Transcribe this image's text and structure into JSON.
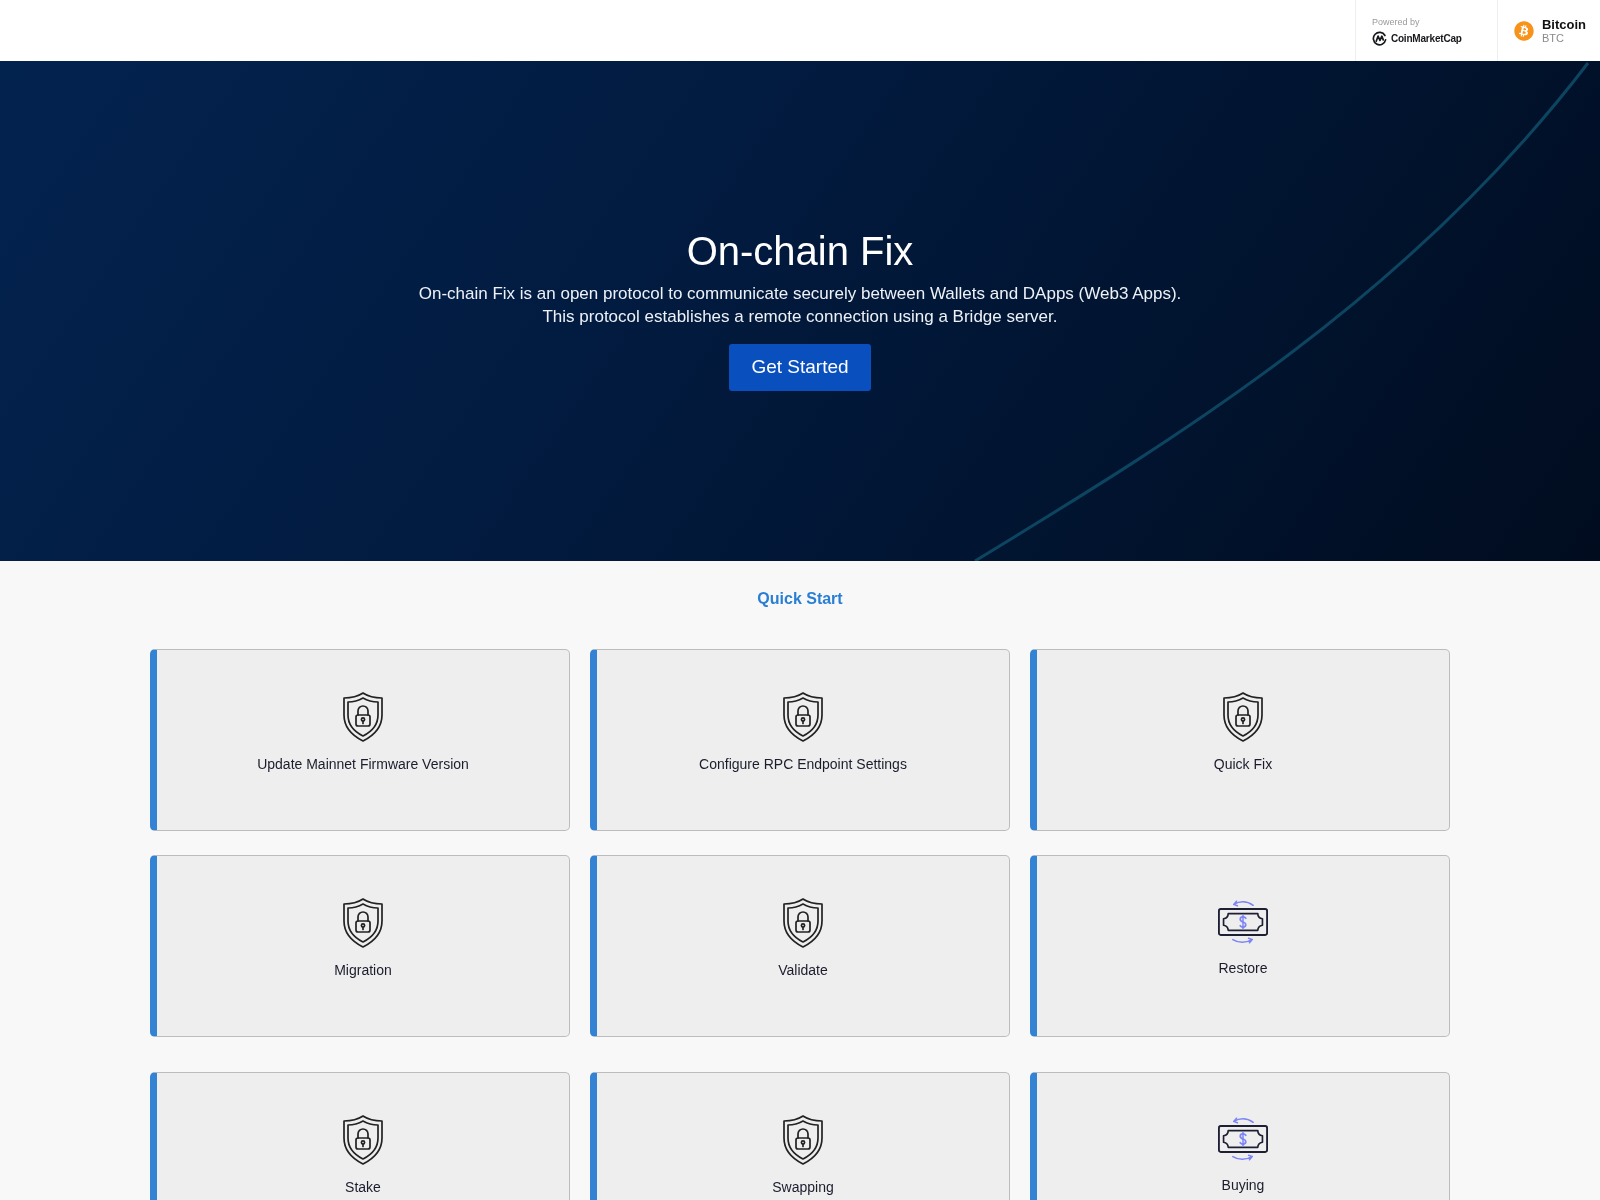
{
  "header": {
    "powered_by": "Powered by",
    "brand": "CoinMarketCap",
    "coin": {
      "name": "Bitcoin",
      "symbol": "BTC"
    }
  },
  "hero": {
    "title": "On-chain Fix",
    "description": [
      "On-chain Fix is an open protocol to communicate securely between Wallets and DApps (Web3 Apps).",
      "This protocol establishes a remote connection using a Bridge server."
    ],
    "button": "Get Started"
  },
  "quick_start": {
    "title": "Quick Start",
    "card_groups": [
      {
        "cards": [
          {
            "label": "Update Mainnet Firmware Version",
            "kind": "shield"
          },
          {
            "label": "Configure RPC Endpoint Settings",
            "kind": "shield"
          },
          {
            "label": "Quick Fix",
            "kind": "shield"
          },
          {
            "label": "Migration",
            "kind": "shield"
          },
          {
            "label": "Validate",
            "kind": "shield"
          },
          {
            "label": "Restore",
            "kind": "money"
          }
        ]
      },
      {
        "cards": [
          {
            "label": "Stake",
            "kind": "shield"
          },
          {
            "label": "Swapping",
            "kind": "shield"
          },
          {
            "label": "Buying",
            "kind": "money"
          }
        ]
      }
    ]
  }
}
